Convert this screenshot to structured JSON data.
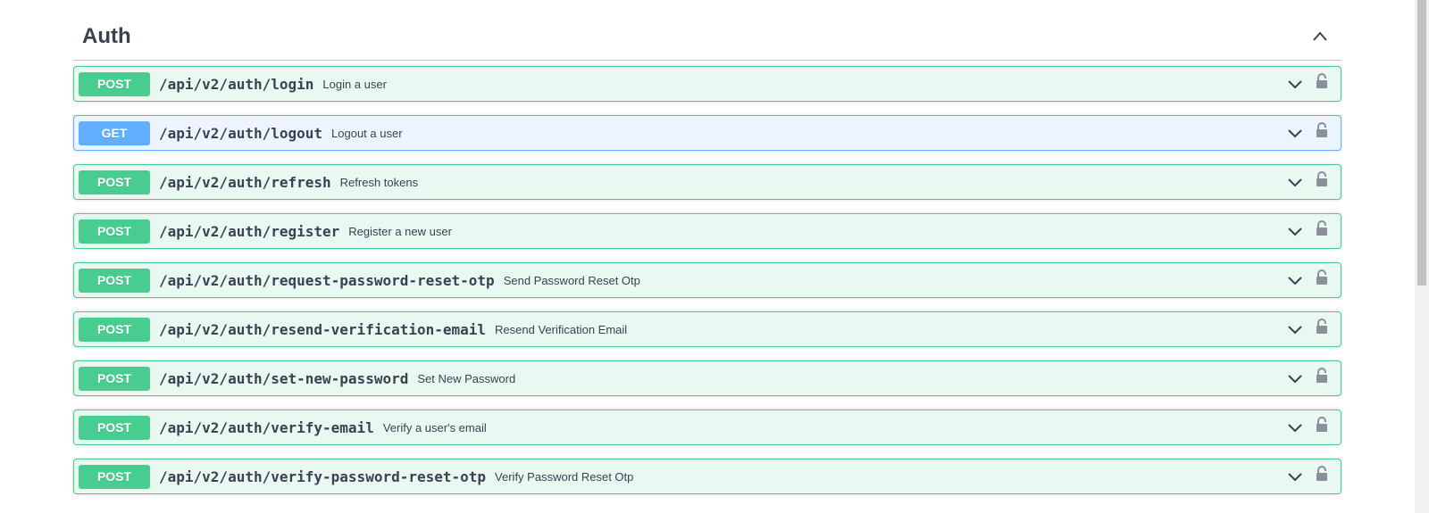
{
  "section": {
    "title": "Auth"
  },
  "colors": {
    "post": "#49cc90",
    "get": "#61affe",
    "text": "#3b4151"
  },
  "operations": [
    {
      "method": "POST",
      "path": "/api/v2/auth/login",
      "summary": "Login a user"
    },
    {
      "method": "GET",
      "path": "/api/v2/auth/logout",
      "summary": "Logout a user"
    },
    {
      "method": "POST",
      "path": "/api/v2/auth/refresh",
      "summary": "Refresh tokens"
    },
    {
      "method": "POST",
      "path": "/api/v2/auth/register",
      "summary": "Register a new user"
    },
    {
      "method": "POST",
      "path": "/api/v2/auth/request-password-reset-otp",
      "summary": "Send Password Reset Otp"
    },
    {
      "method": "POST",
      "path": "/api/v2/auth/resend-verification-email",
      "summary": "Resend Verification Email"
    },
    {
      "method": "POST",
      "path": "/api/v2/auth/set-new-password",
      "summary": "Set New Password"
    },
    {
      "method": "POST",
      "path": "/api/v2/auth/verify-email",
      "summary": "Verify a user's email"
    },
    {
      "method": "POST",
      "path": "/api/v2/auth/verify-password-reset-otp",
      "summary": "Verify Password Reset Otp"
    }
  ],
  "icons": {
    "collapse": "chevron-up-icon",
    "expand": "chevron-down-icon",
    "auth": "lock-icon"
  }
}
